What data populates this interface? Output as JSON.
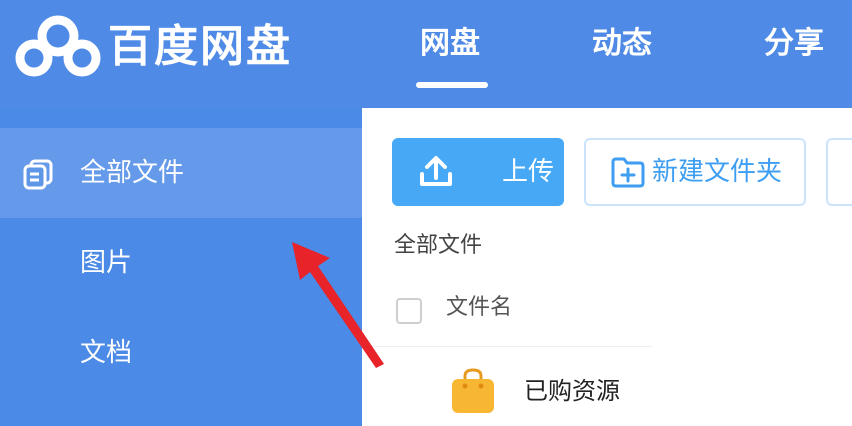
{
  "header": {
    "brand": "百度网盘",
    "logo_icon": "baidu-cloud-logo-icon",
    "tabs": [
      {
        "label": "网盘",
        "active": true
      },
      {
        "label": "动态",
        "active": false
      },
      {
        "label": "分享",
        "active": false
      }
    ]
  },
  "sidebar": {
    "items": [
      {
        "label": "全部文件",
        "icon": "files-stack-icon",
        "active": true
      },
      {
        "label": "图片",
        "active": false
      },
      {
        "label": "文档",
        "active": false
      }
    ]
  },
  "toolbar": {
    "upload_label": "上传",
    "upload_icon": "upload-icon",
    "new_folder_label": "新建文件夹",
    "new_folder_icon": "folder-plus-icon"
  },
  "main": {
    "breadcrumb": "全部文件",
    "column_filename": "文件名",
    "files": [
      {
        "name": "已购资源",
        "icon": "shopping-bag-icon"
      }
    ]
  },
  "colors": {
    "header_bg": "#4f8be6",
    "sidebar_bg": "#4b8ae6",
    "upload_btn": "#47a8f5",
    "new_folder_text": "#3e9ef2",
    "annotation_arrow": "#e8232a",
    "bag_icon": "#f7b733"
  }
}
